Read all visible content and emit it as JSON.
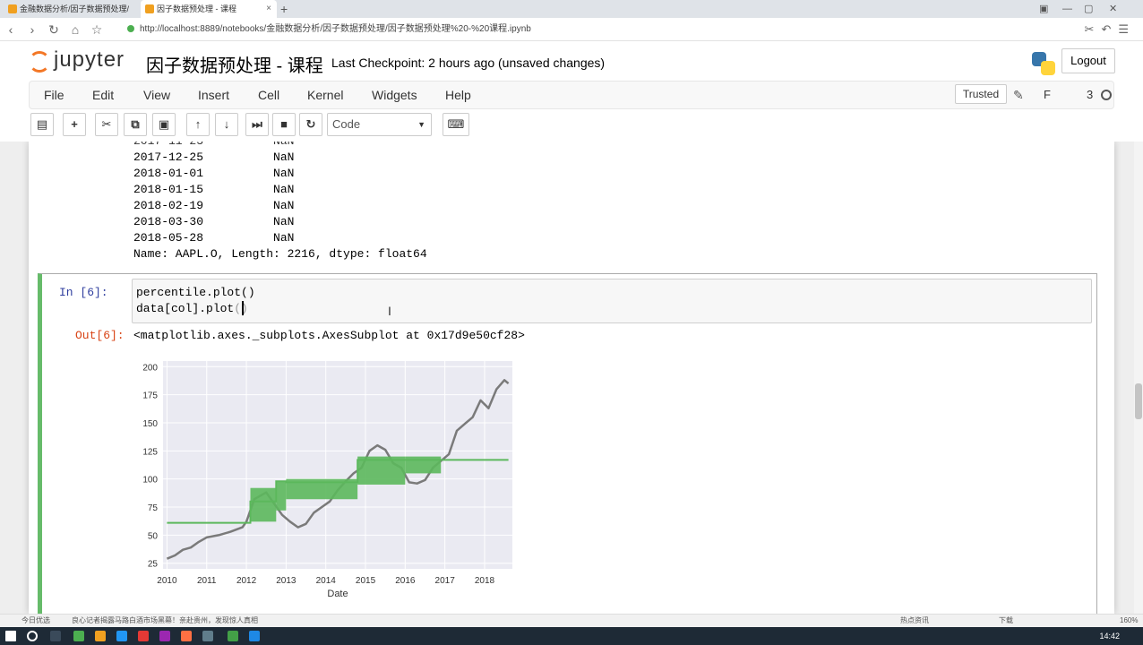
{
  "browser": {
    "tabs": [
      {
        "label": "金融数据分析/因子数据预处理/"
      },
      {
        "label": "因子数据预处理 - 课程"
      }
    ],
    "new_tab_label": "+",
    "url": "http://localhost:8889/notebooks/金融数据分析/因子数据预处理/因子数据预处理%20-%20课程.ipynb"
  },
  "header": {
    "logo_text": "jupyter",
    "notebook_title": "因子数据预处理 - 课程",
    "checkpoint": "Last Checkpoint: 2 hours ago (unsaved changes)",
    "logout_label": "Logout"
  },
  "menubar": {
    "items": [
      "File",
      "Edit",
      "View",
      "Insert",
      "Cell",
      "Kernel",
      "Widgets",
      "Help"
    ],
    "trusted_label": "Trusted",
    "kernel_letter": "F",
    "kernel_num": "3"
  },
  "toolbar": {
    "cell_type": "Code"
  },
  "notebook": {
    "prev_output": [
      "2017-12-25          NaN",
      "2018-01-01          NaN",
      "2018-01-15          NaN",
      "2018-02-19          NaN",
      "2018-03-30          NaN",
      "2018-05-28          NaN",
      "Name: AAPL.O, Length: 2216, dtype: float64"
    ],
    "cell": {
      "in_prompt": "In  [6]:",
      "code_line1": "percentile.plot()",
      "code_line2_text": "data[col].plot",
      "code_line2_paren": "()",
      "out_prompt": "Out[6]:",
      "out_text": "<matplotlib.axes._subplots.AxesSubplot at 0x17d9e50cf28>"
    }
  },
  "chart_data": {
    "type": "line",
    "xlabel": "Date",
    "ylabel": "",
    "xlim": [
      2009.9,
      2018.7
    ],
    "ylim": [
      20,
      205
    ],
    "x_ticks": [
      "2010",
      "2011",
      "2012",
      "2013",
      "2014",
      "2015",
      "2016",
      "2017",
      "2018"
    ],
    "y_ticks": [
      25,
      50,
      75,
      100,
      125,
      150,
      175,
      200
    ],
    "grid": true,
    "colors": {
      "price": "#7a7a7a",
      "percentile": "#5cb85c",
      "background": "#eaeaf2"
    },
    "series": [
      {
        "x": [
          2010.0,
          2010.2,
          2010.4,
          2010.6,
          2010.8,
          2011.0,
          2011.3,
          2011.6,
          2011.9,
          2012.0,
          2012.2,
          2012.5,
          2012.7,
          2012.9,
          2013.1,
          2013.3,
          2013.5,
          2013.7,
          2013.9,
          2014.1,
          2014.3,
          2014.5,
          2014.7,
          2014.9,
          2015.1,
          2015.3,
          2015.5,
          2015.7,
          2015.9,
          2016.1,
          2016.3,
          2016.5,
          2016.7,
          2016.9,
          2017.1,
          2017.3,
          2017.5,
          2017.7,
          2017.9,
          2018.1,
          2018.3,
          2018.5,
          2018.6
        ],
        "values": [
          29,
          32,
          37,
          39,
          44,
          48,
          50,
          53,
          57,
          62,
          82,
          88,
          78,
          68,
          62,
          57,
          60,
          70,
          75,
          80,
          90,
          98,
          105,
          110,
          125,
          130,
          126,
          114,
          110,
          97,
          96,
          99,
          110,
          116,
          122,
          143,
          149,
          155,
          170,
          163,
          180,
          188,
          185
        ]
      },
      {
        "x": [
          2010.0,
          2012.1,
          2012.1,
          2012.75,
          2012.75,
          2013.0,
          2013.0,
          2014.8,
          2014.8,
          2016.0,
          2016.0,
          2018.6
        ],
        "values": [
          61,
          61,
          80,
          80,
          98,
          98,
          97,
          97,
          117,
          117,
          117,
          117
        ]
      }
    ]
  },
  "statusbar": {
    "left": "今日优选",
    "news": "良心记者揭露马路白酒市场黑幕！亲赴贵州，发现惊人真相",
    "right1": "热点资讯",
    "right2": "下载",
    "zoom": "160%"
  },
  "taskbar": {
    "clock": "14:42"
  }
}
